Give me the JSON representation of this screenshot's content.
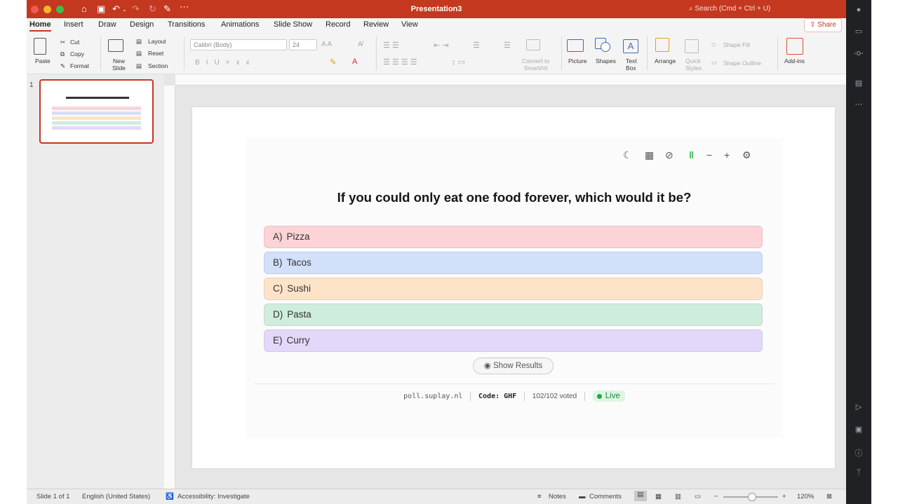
{
  "window": {
    "title": "Presentation3",
    "search_placeholder": "Search (Cmd + Ctrl + U)"
  },
  "tabs": [
    "Home",
    "Insert",
    "Draw",
    "Design",
    "Transitions",
    "Animations",
    "Slide Show",
    "Record",
    "Review",
    "View"
  ],
  "share_label": "Share",
  "ribbon": {
    "paste": "Paste",
    "cut": "Cut",
    "copy": "Copy",
    "format": "Format",
    "new_slide_1": "New",
    "new_slide_2": "Slide",
    "layout": "Layout",
    "reset": "Reset",
    "section": "Section",
    "font": "Calibri (Body)",
    "size": "24",
    "convert_1": "Convert to",
    "convert_2": "SmartArt",
    "picture": "Picture",
    "shapes": "Shapes",
    "textbox_1": "Text",
    "textbox_2": "Box",
    "arrange": "Arrange",
    "quick_1": "Quick",
    "quick_2": "Styles",
    "shape_fill": "Shape Fill",
    "shape_outline": "Shape Outline",
    "addins": "Add-ins"
  },
  "thumbnail_number": "1",
  "poll": {
    "question": "If you could only eat one food forever, which would it be?",
    "options": [
      {
        "label": "A)",
        "text": "Pizza",
        "color": "#fcd3d6"
      },
      {
        "label": "B)",
        "text": "Tacos",
        "color": "#d2e0fa"
      },
      {
        "label": "C)",
        "text": "Sushi",
        "color": "#fde3c8"
      },
      {
        "label": "D)",
        "text": "Pasta",
        "color": "#cfeddc"
      },
      {
        "label": "E)",
        "text": "Curry",
        "color": "#e4d8fa"
      }
    ],
    "show_results": "Show Results",
    "site": "poll.suplay.nl",
    "code": "Code: GHF",
    "voted": "102/102 voted",
    "live": "Live"
  },
  "status": {
    "slide": "Slide 1 of 1",
    "language": "English (United States)",
    "accessibility": "Accessibility: Investigate",
    "notes": "Notes",
    "comments": "Comments",
    "zoom": "120%"
  }
}
